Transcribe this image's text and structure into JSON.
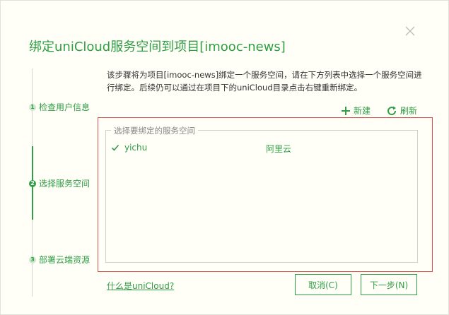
{
  "dialog": {
    "title": "绑定uniCloud服务空间到项目[imooc-news]",
    "description": "该步骤将为项目[imooc-news]绑定一个服务空间，请在下方列表中选择一个服务空间进行绑定。后续仍可以通过在项目下的uniCloud目录点击右键重新绑定。"
  },
  "steps": [
    {
      "label": "检查用户信息",
      "index": "1",
      "active": false
    },
    {
      "label": "选择服务空间",
      "index": "2",
      "active": true
    },
    {
      "label": "部署云端资源",
      "index": "3",
      "active": false
    }
  ],
  "actions": {
    "new_label": "新建",
    "refresh_label": "刷新"
  },
  "space_list": {
    "legend": "选择要绑定的服务空间",
    "items": [
      {
        "name": "yichu",
        "provider": "阿里云",
        "selected": true
      }
    ]
  },
  "footer": {
    "help_link": "什么是uniCloud?",
    "cancel_label": "取消(C)",
    "next_label": "下一步(N)"
  },
  "colors": {
    "accent": "#2f9e45",
    "highlight_border": "#d9534f",
    "background": "#fffef7"
  },
  "icons": {
    "close": "close-icon",
    "new": "plus-icon",
    "refresh": "refresh-icon",
    "check": "check-icon"
  }
}
